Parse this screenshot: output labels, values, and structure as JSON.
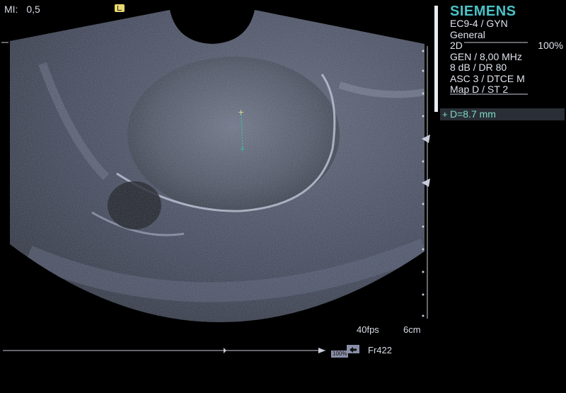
{
  "header": {
    "mi_label": "MI:",
    "mi_value": "0,5"
  },
  "info_panel": {
    "brand": "SIEMENS",
    "probe": "EC9-4 / GYN",
    "preset": "General",
    "mode": "2D",
    "power_percent": "100%",
    "lines": [
      "GEN / 8,00 MHz",
      "8 dB / DR 80",
      "ASC 3 / DTCE M",
      "Map D / ST 2"
    ]
  },
  "measurement": {
    "label": "D=8.7 mm"
  },
  "footer": {
    "frame_rate": "40fps",
    "depth": "6cm",
    "zoom_badge": "100%",
    "frame": "Fr422"
  },
  "colors": {
    "measure_text": "#7fd8c8",
    "caliper": "#e3d98a"
  }
}
